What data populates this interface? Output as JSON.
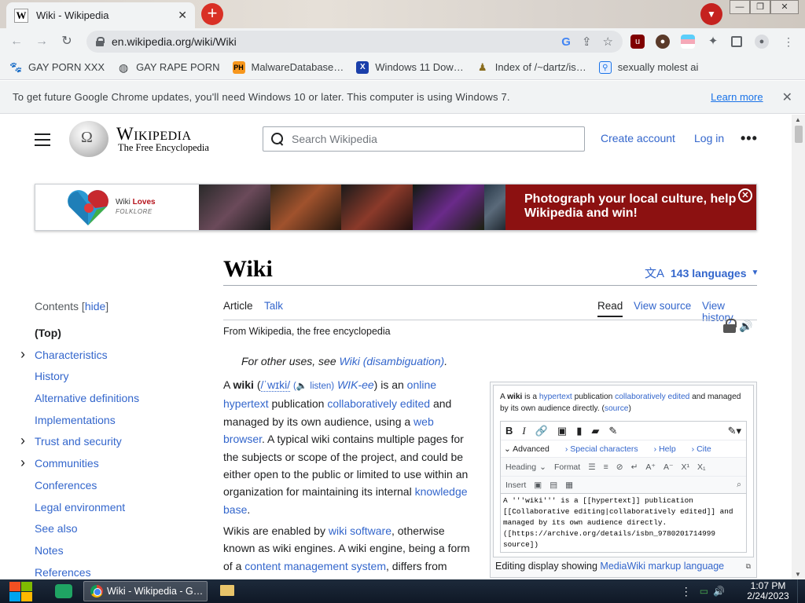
{
  "browser": {
    "tab_title": "Wiki - Wikipedia",
    "tab_favicon": "W",
    "url": "en.wikipedia.org/wiki/Wiki",
    "bookmarks": [
      {
        "label": "GAY PORN XXX",
        "icon": "paw-icon"
      },
      {
        "label": "GAY RAPE PORN",
        "icon": "globe-icon"
      },
      {
        "label": "MalwareDatabase…",
        "icon": "ph-icon"
      },
      {
        "label": "Windows 11 Dow…",
        "icon": "x-icon"
      },
      {
        "label": "Index of /~dartz/is…",
        "icon": "user-icon"
      },
      {
        "label": "sexually molest ai",
        "icon": "page-icon"
      }
    ],
    "infobar_message": "To get future Google Chrome updates, you'll need Windows 10 or later. This computer is using Windows 7.",
    "infobar_link": "Learn more"
  },
  "wiki": {
    "wordmark": "Wikipedia",
    "tagline": "The Free Encyclopedia",
    "search_placeholder": "Search Wikipedia",
    "create_account": "Create account",
    "log_in": "Log in",
    "banner": {
      "logo_line1_a": "Wiki ",
      "logo_line1_b": "Loves",
      "logo_line2": "FOLKLORE",
      "cta": "Photograph your local culture, help Wikipedia and win!"
    },
    "toc": {
      "title": "Contents",
      "hide": "hide",
      "items": [
        {
          "label": "(Top)",
          "expandable": false
        },
        {
          "label": "Characteristics",
          "expandable": true
        },
        {
          "label": "History",
          "expandable": false
        },
        {
          "label": "Alternative definitions",
          "expandable": false
        },
        {
          "label": "Implementations",
          "expandable": false
        },
        {
          "label": "Trust and security",
          "expandable": true
        },
        {
          "label": "Communities",
          "expandable": true
        },
        {
          "label": "Conferences",
          "expandable": false
        },
        {
          "label": "Legal environment",
          "expandable": false
        },
        {
          "label": "See also",
          "expandable": false
        },
        {
          "label": "Notes",
          "expandable": false
        },
        {
          "label": "References",
          "expandable": false
        }
      ]
    },
    "article": {
      "title": "Wiki",
      "languages": "143 languages",
      "tabs": {
        "article": "Article",
        "talk": "Talk",
        "read": "Read",
        "view_source": "View source",
        "view_history": "View history"
      },
      "from": "From Wikipedia, the free encyclopedia",
      "hatnote_prefix": "For other uses, see ",
      "hatnote_link": "Wiki (disambiguation)",
      "hatnote_suffix": "."
    },
    "figure": {
      "caption_prefix": "Editing display showing ",
      "caption_link": "MediaWiki markup language",
      "editor_code": "A '''wiki''' is a [[hypertext]] publication\n[[Collaborative editing|collaboratively edited]] and\nmanaged by its own audience directly.\n([https://archive.org/details/isbn_9780201714999\nsource])",
      "toolbar_advanced": "Advanced",
      "toolbar_special": "Special characters",
      "toolbar_help": "Help",
      "toolbar_cite": "Cite",
      "heading": "Heading",
      "format": "Format",
      "insert": "Insert"
    }
  },
  "taskbar": {
    "chrome_label": "Wiki - Wikipedia - G…",
    "time": "1:07 PM",
    "date": "2/24/2023"
  }
}
